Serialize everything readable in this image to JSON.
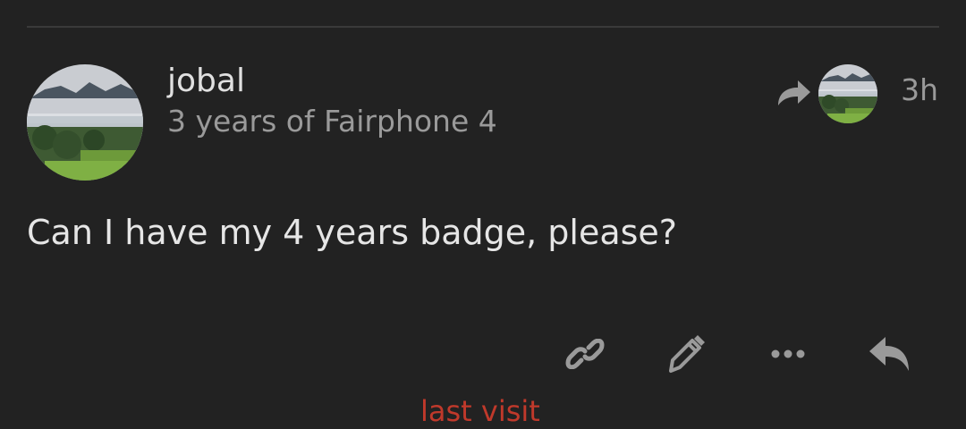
{
  "post": {
    "username": "jobal",
    "user_title": "3 years of Fairphone 4",
    "timestamp": "3h",
    "body": "Can I have my 4 years badge, please?"
  },
  "actions": {
    "link_icon": "link-icon",
    "edit_icon": "pencil-icon",
    "more_icon": "ellipsis-icon",
    "reply_icon": "reply-icon"
  },
  "footer": {
    "partial_text": "last visit"
  },
  "colors": {
    "background": "#222222",
    "divider": "#3a3a3a",
    "text_primary": "#e6e6e6",
    "text_muted": "#9a9a9a",
    "icon": "#9a9a9a",
    "accent_red": "#c0392b"
  }
}
